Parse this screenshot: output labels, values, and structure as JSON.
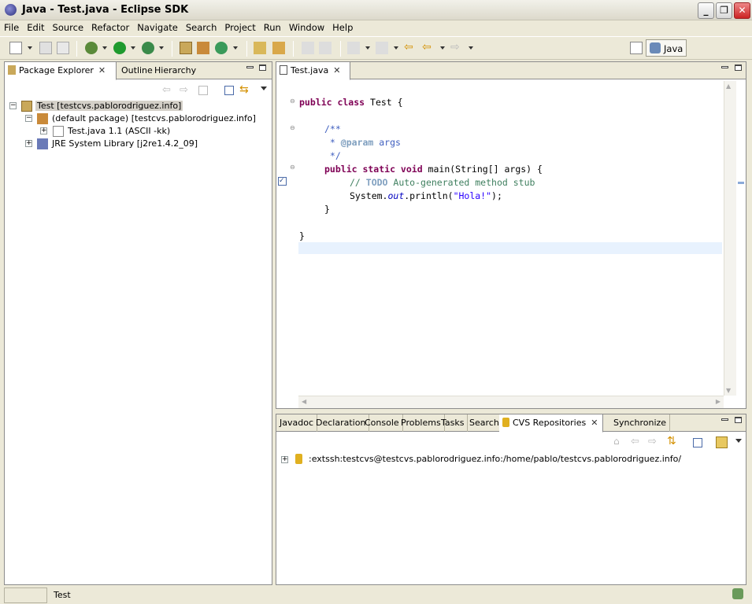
{
  "window": {
    "title": "Java - Test.java - Eclipse SDK"
  },
  "menu": [
    "File",
    "Edit",
    "Source",
    "Refactor",
    "Navigate",
    "Search",
    "Project",
    "Run",
    "Window",
    "Help"
  ],
  "perspective": {
    "label": "Java"
  },
  "left_panel": {
    "tabs": [
      "Package Explorer",
      "Outline",
      "Hierarchy"
    ],
    "tree": [
      {
        "label": "Test  [testcvs.pablorodriguez.info]"
      },
      {
        "label": "(default package)  [testcvs.pablorodriguez.info]"
      },
      {
        "label": "Test.java  1.1  (ASCII -kk)"
      },
      {
        "label": "JRE System Library [j2re1.4.2_09]"
      }
    ]
  },
  "editor": {
    "tab": "Test.java",
    "lines": {
      "l1_kw": "public class",
      "l1_rest": " Test {",
      "l3": "/**",
      "l4_star": " * ",
      "l4_tag": "@param",
      "l4_rest": " args",
      "l5": " */",
      "l6_kw": "public static void",
      "l6_rest": " main(String[] args) {",
      "l7_cm": "// ",
      "l7_todo": "TODO",
      "l7_rest": " Auto-generated method stub",
      "l8_a": "System.",
      "l8_out": "out",
      "l8_b": ".println(",
      "l8_str": "\"Hola!\"",
      "l8_c": ");",
      "l9": "}",
      "l11": "}"
    }
  },
  "bottom_panel": {
    "tabs": [
      "Javadoc",
      "Declaration",
      "Console",
      "Problems",
      "Tasks",
      "Search",
      "CVS Repositories",
      "Synchronize"
    ],
    "repository": ":extssh:testcvs@testcvs.pablorodriguez.info:/home/pablo/testcvs.pablorodriguez.info/"
  },
  "status": {
    "text": "Test"
  }
}
